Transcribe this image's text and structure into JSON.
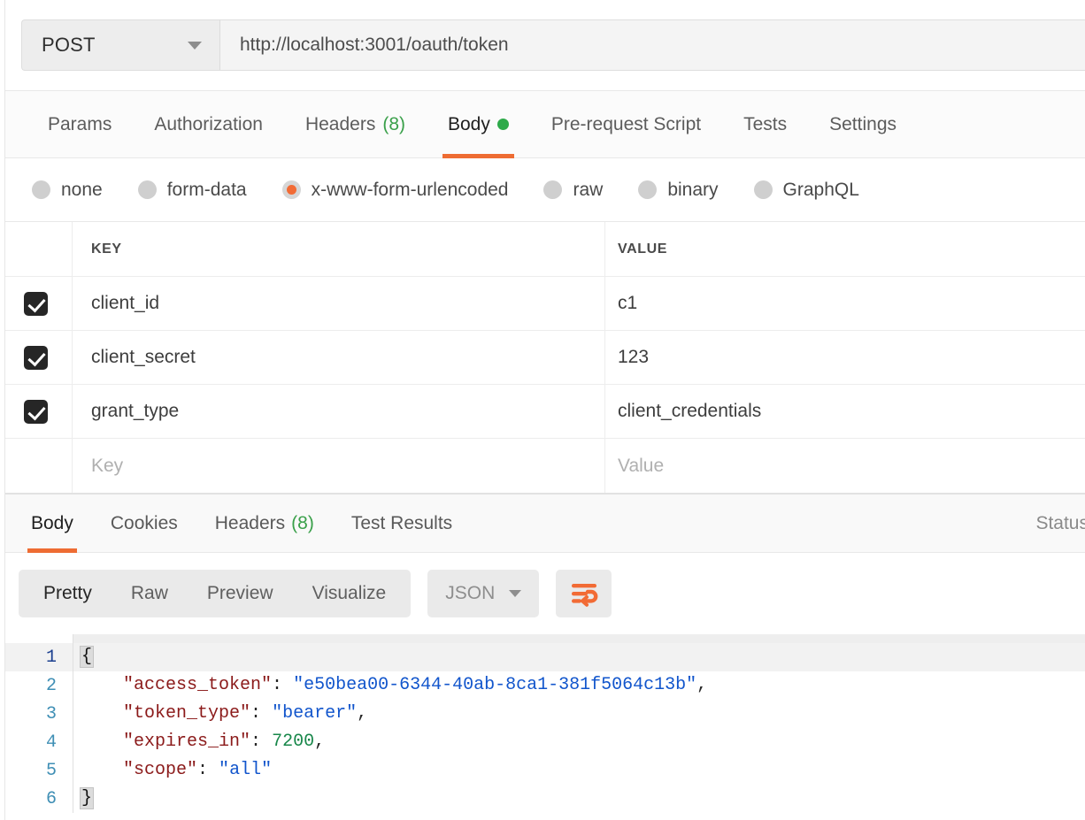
{
  "request": {
    "method": "POST",
    "method_chevron_icon": "chevron-down-icon",
    "url": "http://localhost:3001/oauth/token",
    "tabs": [
      {
        "label": "Params",
        "active": false
      },
      {
        "label": "Authorization",
        "active": false
      },
      {
        "label": "Headers",
        "count": "(8)",
        "active": false
      },
      {
        "label": "Body",
        "active": true,
        "dot": true
      },
      {
        "label": "Pre-request Script",
        "active": false
      },
      {
        "label": "Tests",
        "active": false
      },
      {
        "label": "Settings",
        "active": false
      }
    ],
    "body_types": [
      {
        "label": "none",
        "selected": false
      },
      {
        "label": "form-data",
        "selected": false
      },
      {
        "label": "x-www-form-urlencoded",
        "selected": true
      },
      {
        "label": "raw",
        "selected": false
      },
      {
        "label": "binary",
        "selected": false
      },
      {
        "label": "GraphQL",
        "selected": false
      }
    ],
    "table": {
      "headers": {
        "key": "KEY",
        "value": "VALUE"
      },
      "rows": [
        {
          "checked": true,
          "key": "client_id",
          "value": "c1"
        },
        {
          "checked": true,
          "key": "client_secret",
          "value": "123"
        },
        {
          "checked": true,
          "key": "grant_type",
          "value": "client_credentials"
        }
      ],
      "placeholder_row": {
        "key": "Key",
        "value": "Value"
      }
    }
  },
  "response": {
    "tabs": [
      {
        "label": "Body",
        "active": true
      },
      {
        "label": "Cookies",
        "active": false
      },
      {
        "label": "Headers",
        "count": "(8)",
        "active": false
      },
      {
        "label": "Test Results",
        "active": false
      }
    ],
    "status_label": "Status",
    "format_tabs": [
      {
        "label": "Pretty",
        "active": true
      },
      {
        "label": "Raw",
        "active": false
      },
      {
        "label": "Preview",
        "active": false
      },
      {
        "label": "Visualize",
        "active": false
      }
    ],
    "language_select": {
      "value": "JSON",
      "chevron_icon": "chevron-down-icon"
    },
    "wrap_button_icon": "word-wrap-icon",
    "code": {
      "line_numbers": [
        "1",
        "2",
        "3",
        "4",
        "5",
        "6"
      ],
      "lines": [
        {
          "n": "1",
          "text": "{"
        },
        {
          "n": "2",
          "text": "    \"access_token\": \"e50bea00-6344-40ab-8ca1-381f5064c13b\","
        },
        {
          "n": "3",
          "text": "    \"token_type\": \"bearer\","
        },
        {
          "n": "4",
          "text": "    \"expires_in\": 7200,"
        },
        {
          "n": "5",
          "text": "    \"scope\": \"all\""
        },
        {
          "n": "6",
          "text": "}"
        }
      ],
      "json_values": {
        "access_token": "e50bea00-6344-40ab-8ca1-381f5064c13b",
        "token_type": "bearer",
        "expires_in": "7200",
        "scope": "all"
      },
      "json_keys": {
        "access_token": "\"access_token\"",
        "token_type": "\"token_type\"",
        "expires_in": "\"expires_in\"",
        "scope": "\"scope\""
      }
    }
  },
  "colors": {
    "accent_orange": "#ee6c33",
    "green_dot": "#2eaa4a",
    "radio_orange": "#f26b35",
    "json_key": "#8b1a1a",
    "json_string": "#1155cc",
    "json_number": "#18874a",
    "line_number": "#3f8fb5"
  }
}
